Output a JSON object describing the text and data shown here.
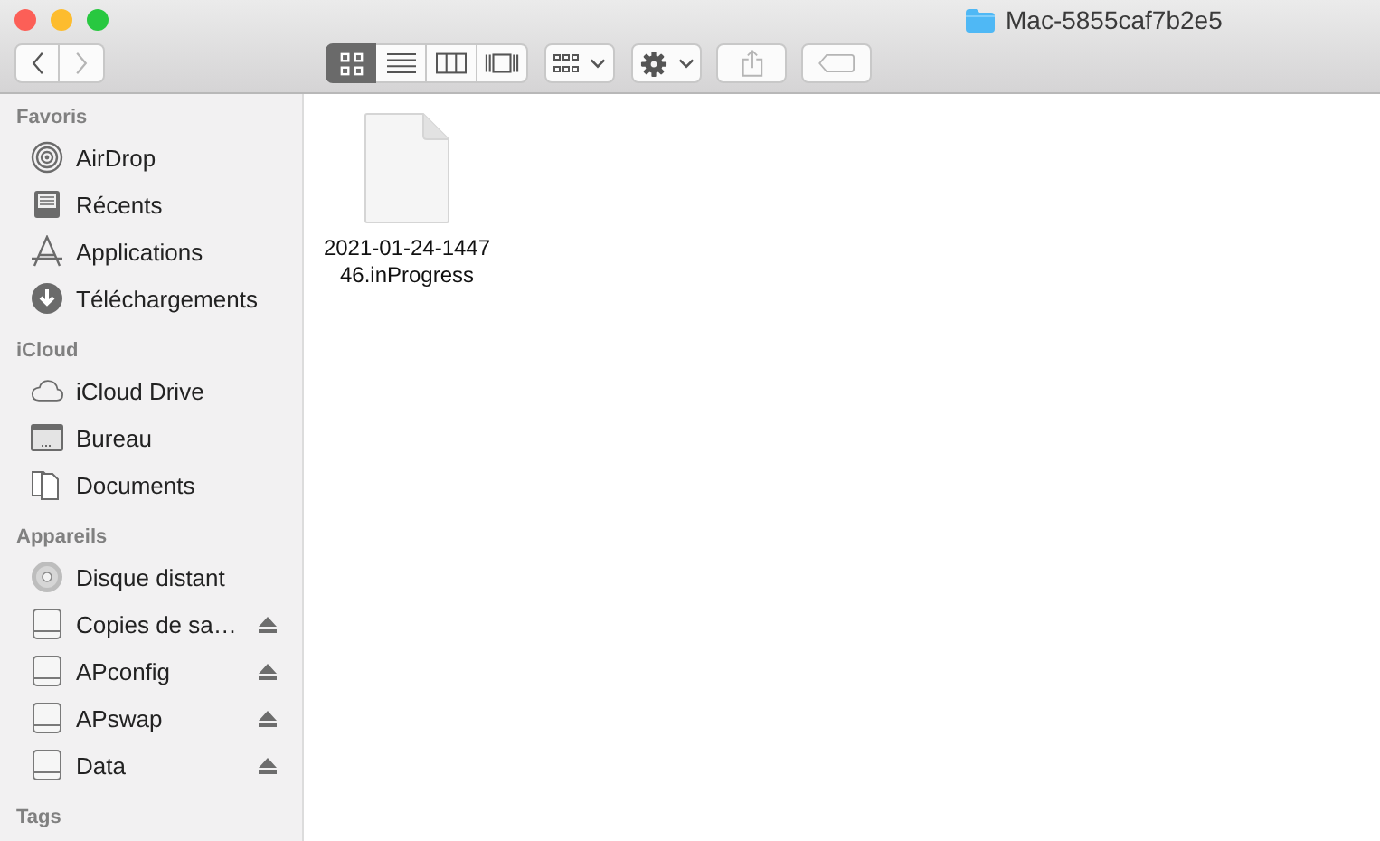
{
  "window": {
    "title": "Mac-5855caf7b2e5"
  },
  "toolbar": {
    "back": {
      "disabled": false
    },
    "forward": {
      "disabled": true
    },
    "view_modes": [
      {
        "kind": "icons",
        "selected": true
      },
      {
        "kind": "list",
        "selected": false
      },
      {
        "kind": "columns",
        "selected": false
      },
      {
        "kind": "gallery",
        "selected": false
      }
    ],
    "share": {
      "disabled": true
    },
    "tags": {
      "disabled": true
    }
  },
  "sidebar": {
    "sections": [
      {
        "title": "Favoris",
        "items": [
          {
            "label": "AirDrop",
            "kind": "airdrop",
            "ejectable": false
          },
          {
            "label": "Récents",
            "kind": "recents",
            "ejectable": false
          },
          {
            "label": "Applications",
            "kind": "apps",
            "ejectable": false
          },
          {
            "label": "Téléchargements",
            "kind": "downloads",
            "ejectable": false
          }
        ]
      },
      {
        "title": "iCloud",
        "items": [
          {
            "label": "iCloud Drive",
            "kind": "cloud",
            "ejectable": false
          },
          {
            "label": "Bureau",
            "kind": "desktop",
            "ejectable": false
          },
          {
            "label": "Documents",
            "kind": "documents",
            "ejectable": false
          }
        ]
      },
      {
        "title": "Appareils",
        "items": [
          {
            "label": "Disque distant",
            "kind": "disc",
            "ejectable": false
          },
          {
            "label": "Copies de sa…",
            "kind": "drive",
            "ejectable": true
          },
          {
            "label": "APconfig",
            "kind": "drive",
            "ejectable": true
          },
          {
            "label": "APswap",
            "kind": "drive",
            "ejectable": true
          },
          {
            "label": "Data",
            "kind": "drive",
            "ejectable": true
          }
        ]
      },
      {
        "title": "Tags"
      }
    ]
  },
  "files": [
    {
      "name": "2021-01-24-144746.inProgress"
    }
  ]
}
